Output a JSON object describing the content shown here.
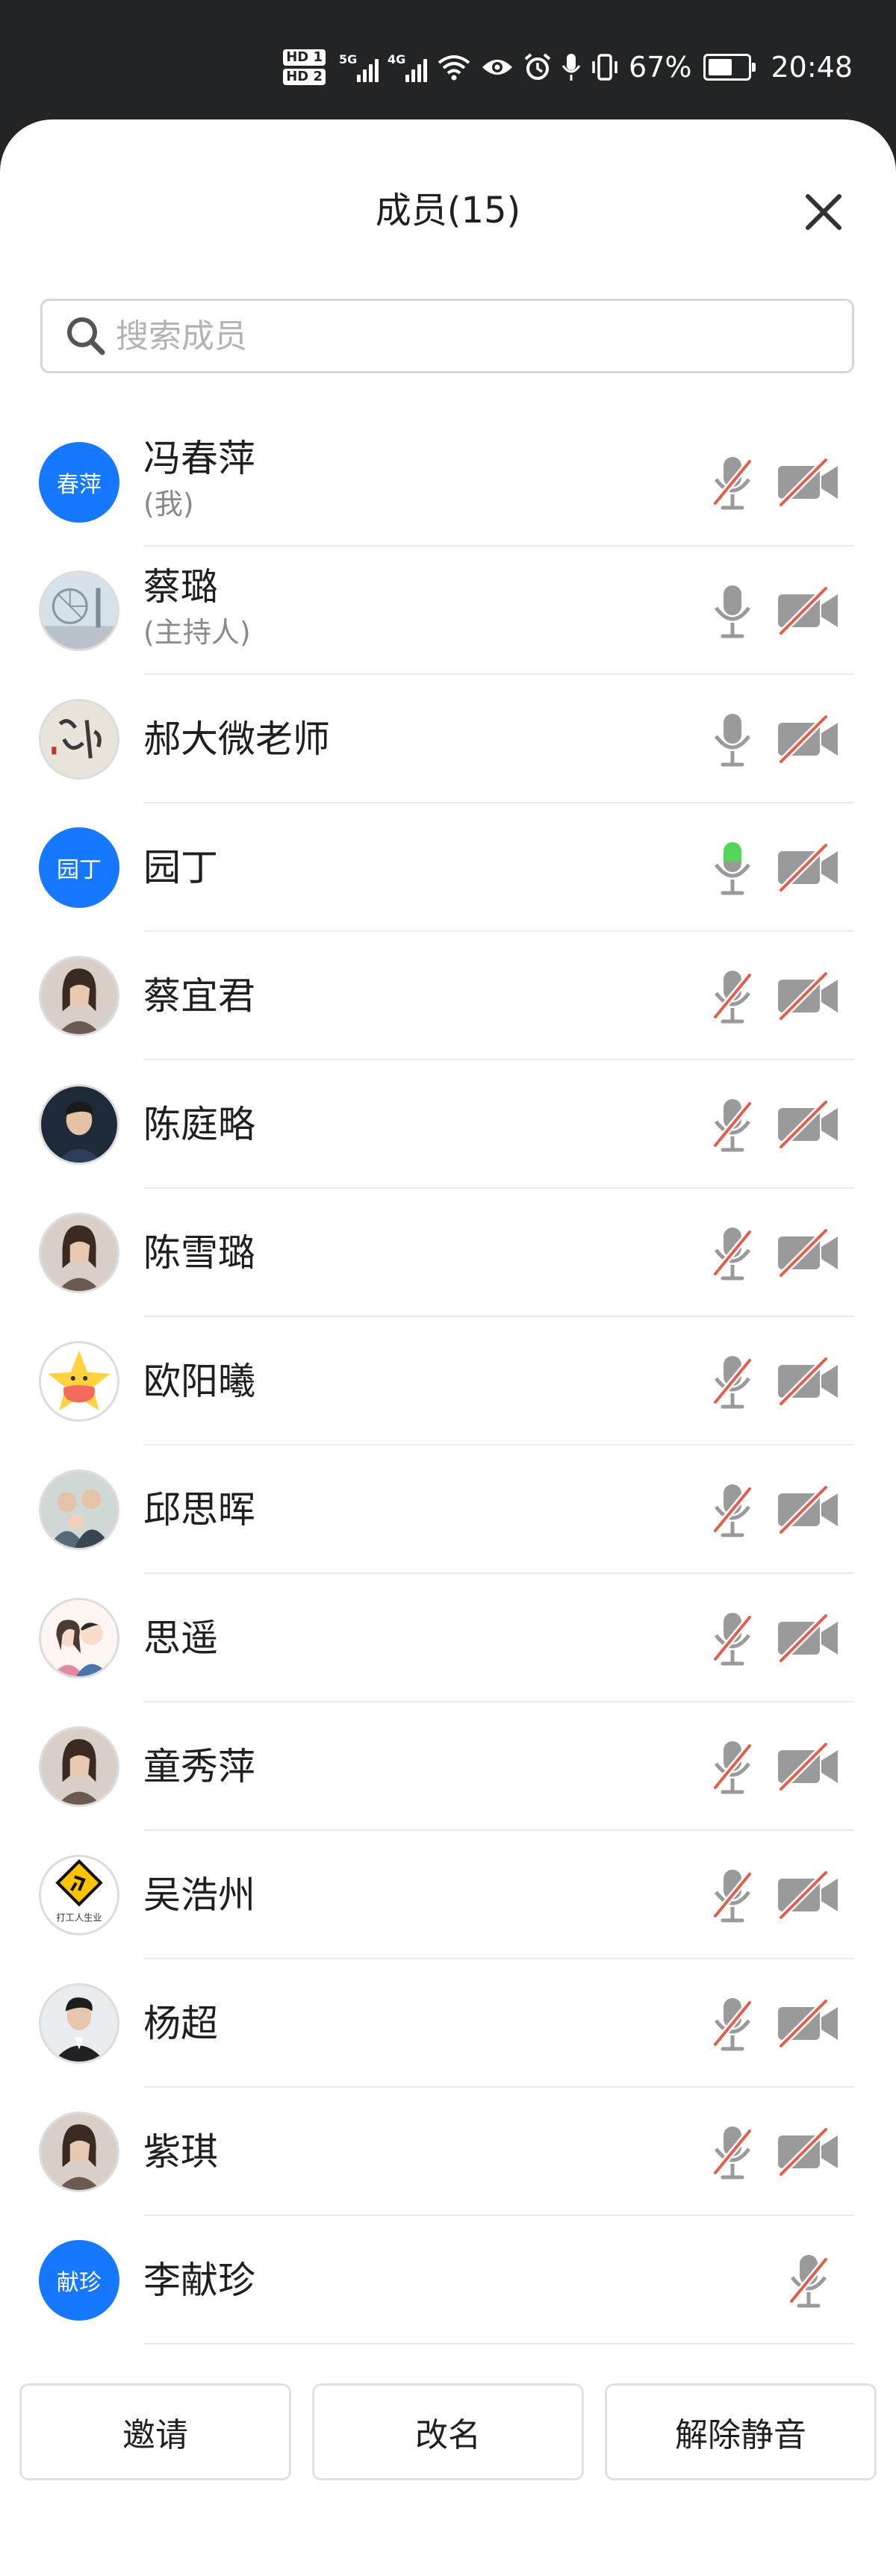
{
  "status_bar": {
    "hd1": "HD 1",
    "hd2": "HD 2",
    "net1": "5G",
    "net2": "4G",
    "battery_text": "67%",
    "battery_level": 0.67,
    "time": "20:48"
  },
  "panel": {
    "title": "成员(15)",
    "search_placeholder": "搜索成员"
  },
  "members": [
    {
      "name": "冯春萍",
      "role": "(我)",
      "avatar_text": "春萍",
      "mic": "muted",
      "camera": "off"
    },
    {
      "name": "蔡璐",
      "role": "(主持人)",
      "avatar_icon": "ferris-wheel-photo",
      "mic": "on",
      "camera": "off"
    },
    {
      "name": "郝大微老师",
      "avatar_icon": "calligraphy-photo",
      "mic": "on",
      "camera": "off"
    },
    {
      "name": "园丁",
      "avatar_text": "园丁",
      "mic": "speaking",
      "camera": "off"
    },
    {
      "name": "蔡宜君",
      "avatar_icon": "woman-portrait-photo",
      "mic": "muted",
      "camera": "off"
    },
    {
      "name": "陈庭略",
      "avatar_icon": "man-portrait-photo",
      "mic": "muted",
      "camera": "off"
    },
    {
      "name": "陈雪璐",
      "avatar_icon": "woman-portrait-photo",
      "mic": "muted",
      "camera": "off"
    },
    {
      "name": "欧阳曦",
      "avatar_icon": "star-cartoon-photo",
      "mic": "muted",
      "camera": "off"
    },
    {
      "name": "邱思晖",
      "avatar_icon": "family-photo",
      "mic": "muted",
      "camera": "off"
    },
    {
      "name": "思遥",
      "avatar_icon": "cartoon-couple-photo",
      "mic": "muted",
      "camera": "off"
    },
    {
      "name": "童秀萍",
      "avatar_icon": "woman-portrait-photo",
      "mic": "muted",
      "camera": "off"
    },
    {
      "name": "吴浩州",
      "avatar_icon": "worker-sign-photo",
      "avatar_caption": "打工人生业",
      "mic": "muted",
      "camera": "off"
    },
    {
      "name": "杨超",
      "avatar_icon": "man-suit-photo",
      "mic": "muted",
      "camera": "off"
    },
    {
      "name": "紫琪",
      "avatar_icon": "woman-portrait-photo",
      "mic": "muted",
      "camera": "off"
    },
    {
      "name": "李献珍",
      "avatar_text": "献珍",
      "mic": "muted"
    }
  ],
  "buttons": {
    "invite": "邀请",
    "rename": "改名",
    "unmute": "解除静音"
  },
  "colors": {
    "accent": "#1677ff",
    "speaking": "#52d65a",
    "muted_slash": "#e0604f",
    "icon_gray": "#9a9a9a",
    "status_bar_bg": "#232425"
  }
}
